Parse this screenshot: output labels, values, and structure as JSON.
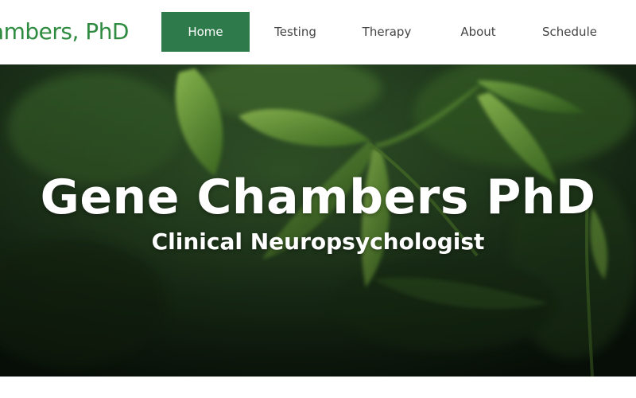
{
  "header": {
    "site_title": "ambers, PhD",
    "nav": [
      {
        "label": "Home",
        "active": true
      },
      {
        "label": "Testing",
        "active": false
      },
      {
        "label": "Therapy",
        "active": false
      },
      {
        "label": "About",
        "active": false
      },
      {
        "label": "Schedule",
        "active": false
      }
    ]
  },
  "hero": {
    "title": "Gene Chambers PhD",
    "subtitle": "Clinical Neuropsychologist"
  },
  "colors": {
    "brand_green": "#2e8b3f",
    "nav_active_bg": "#2f7a4a",
    "nav_text": "#444444",
    "hero_text": "#ffffff"
  }
}
